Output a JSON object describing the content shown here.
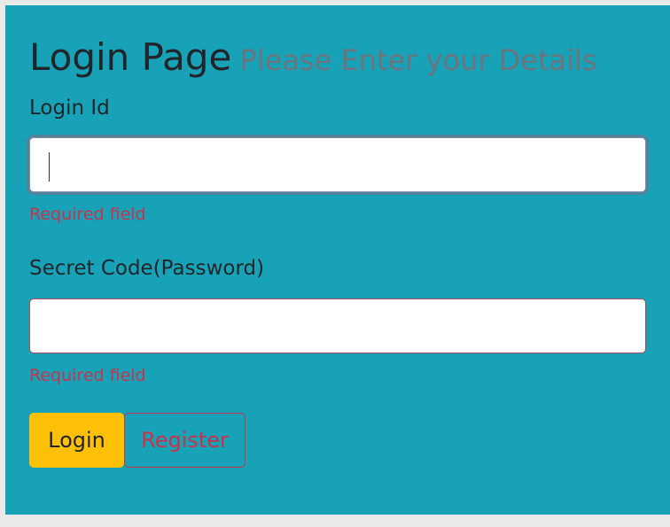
{
  "header": {
    "title": "Login Page",
    "subtitle": "Please Enter your Details"
  },
  "login_id": {
    "label": "Login Id",
    "value": "",
    "error": "Required field"
  },
  "password": {
    "label": "Secret Code(Password)",
    "value": "",
    "error": "Required field"
  },
  "buttons": {
    "login": "Login",
    "register": "Register"
  },
  "colors": {
    "panel": "#17a2b8",
    "login_button": "#ffc107",
    "error": "#c8334c"
  }
}
